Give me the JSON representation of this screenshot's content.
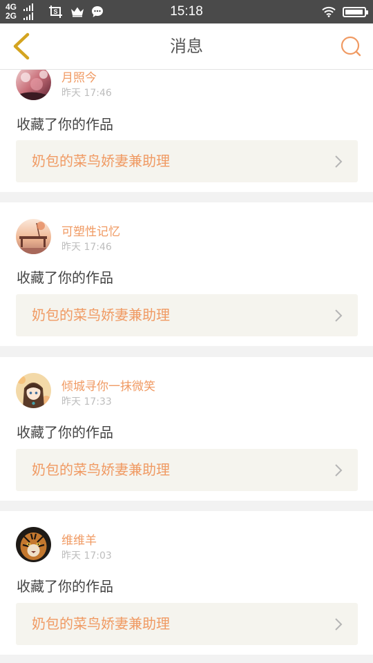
{
  "status_bar": {
    "network_top": "4G",
    "network_bottom": "2G",
    "time": "15:18",
    "battery_level": 0.95
  },
  "nav": {
    "title": "消息"
  },
  "notifications": [
    {
      "user": "月照今",
      "time": "昨天 17:46",
      "action": "收藏了你的作品",
      "work_title": "奶包的菜鸟娇妻兼助理",
      "avatar": "cherry-blossom-avatar"
    },
    {
      "user": "可塑性记忆",
      "time": "昨天 17:46",
      "action": "收藏了你的作品",
      "work_title": "奶包的菜鸟娇妻兼助理",
      "avatar": "bench-sunset-avatar"
    },
    {
      "user": "倾城寻你一抹微笑",
      "time": "昨天 17:33",
      "action": "收藏了你的作品",
      "work_title": "奶包的菜鸟娇妻兼助理",
      "avatar": "anime-girl-avatar"
    },
    {
      "user": "维维羊",
      "time": "昨天 17:03",
      "action": "收藏了你的作品",
      "work_title": "奶包的菜鸟娇妻兼助理",
      "avatar": "tiger-avatar"
    }
  ],
  "colors": {
    "accent": "#f09a63",
    "back_arrow": "#d4a420",
    "status_bar": "#4a4a4a",
    "link_background": "#f5f4ee"
  }
}
